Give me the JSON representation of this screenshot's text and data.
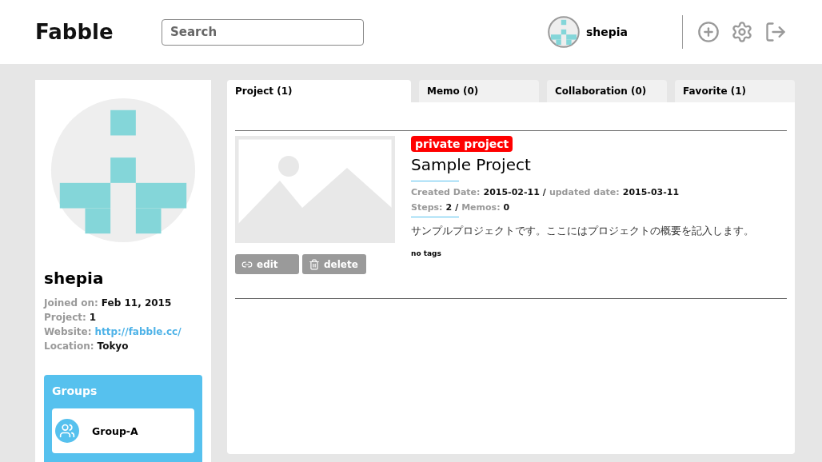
{
  "header": {
    "logo": "Fabble",
    "search": {
      "placeholder": "Search"
    },
    "user": {
      "name": "shepia"
    }
  },
  "profile": {
    "name": "shepia",
    "fields": [
      {
        "label": "Joined on:",
        "value": "Feb 11, 2015",
        "kind": "text"
      },
      {
        "label": "Project:",
        "value": "1",
        "kind": "text"
      },
      {
        "label": "Website:",
        "value": "http://fabble.cc/",
        "kind": "link"
      },
      {
        "label": "Location:",
        "value": "Tokyo",
        "kind": "text"
      }
    ],
    "groups": {
      "title": "Groups",
      "items": [
        {
          "name": "Group-A"
        }
      ]
    }
  },
  "tabs": [
    {
      "label": "Project (1)",
      "selected": true
    },
    {
      "label": "Memo (0)",
      "selected": false
    },
    {
      "label": "Collaboration (0)",
      "selected": false
    },
    {
      "label": "Favorite (1)",
      "selected": false
    }
  ],
  "projects": [
    {
      "badge": "private project",
      "title": "Sample Project",
      "meta": [
        {
          "separator": "/",
          "items": [
            {
              "label": "Created Date:",
              "value": "2015-02-11"
            },
            {
              "label": "updated date:",
              "value": "2015-03-11"
            }
          ]
        },
        {
          "separator": "/",
          "items": [
            {
              "label": "Steps:",
              "value": "2"
            },
            {
              "label": "Memos:",
              "value": "0"
            }
          ]
        }
      ],
      "description": "サンプルプロジェクトです。ここにはプロジェクトの概要を記入します。",
      "tags": "no tags",
      "actions": [
        {
          "label": "edit",
          "kind": "edit"
        },
        {
          "label": "delete",
          "kind": "delete"
        }
      ]
    }
  ]
}
